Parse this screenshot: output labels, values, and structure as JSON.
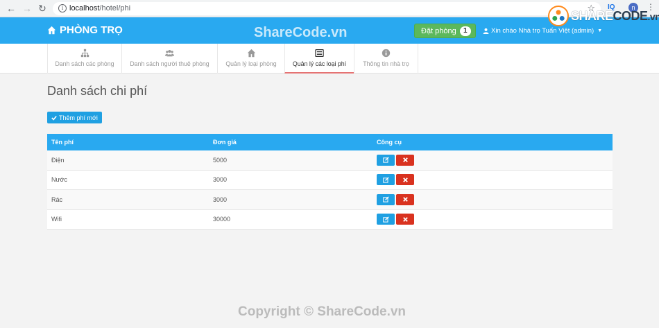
{
  "browser": {
    "url_host": "localhost",
    "url_path": "/hotel/phi",
    "ext_iq": "IQ",
    "avatar_letter": "n"
  },
  "navbar": {
    "brand": "PHÒNG TRỌ",
    "book_label": "Đặt phòng",
    "book_count": "1",
    "greeting": "Xin chào Nhà trọ Tuấn Việt (admin)"
  },
  "watermark": {
    "logo_share": "SHARE",
    "logo_code": "CODE",
    "logo_vn": ".vn",
    "top": "ShareCode.vn",
    "bottom": "Copyright © ShareCode.vn"
  },
  "tabs": [
    {
      "label": "Danh sách các phòng",
      "icon": "sitemap-icon"
    },
    {
      "label": "Danh sách người thuê phòng",
      "icon": "users-icon"
    },
    {
      "label": "Quản lý loại phòng",
      "icon": "home-icon"
    },
    {
      "label": "Quản lý các loại phí",
      "icon": "list-icon",
      "active": true
    },
    {
      "label": "Thông tin nhà trọ",
      "icon": "info-icon"
    }
  ],
  "page": {
    "title": "Danh sách chi phí",
    "add_label": "Thêm phí mới"
  },
  "table": {
    "headers": [
      "Tên phí",
      "Đơn giá",
      "Công cụ"
    ],
    "rows": [
      {
        "name": "Điện",
        "price": "5000"
      },
      {
        "name": "Nước",
        "price": "3000"
      },
      {
        "name": "Rác",
        "price": "3000"
      },
      {
        "name": "Wifi",
        "price": "30000"
      }
    ]
  },
  "colors": {
    "primary": "#29a9f0",
    "success": "#5cb85c",
    "danger": "#d9321f",
    "active_tab_border": "#e57373"
  }
}
